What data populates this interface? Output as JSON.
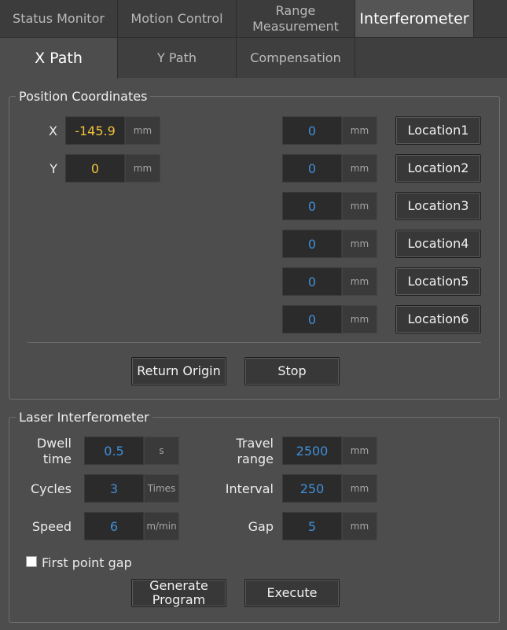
{
  "tabs_main": [
    {
      "label": "Status Monitor"
    },
    {
      "label": "Motion Control"
    },
    {
      "label": "Range Measurement"
    },
    {
      "label": "Interferometer"
    }
  ],
  "tabs_sub": [
    {
      "label": "X Path"
    },
    {
      "label": "Y Path"
    },
    {
      "label": "Compensation"
    }
  ],
  "position": {
    "title": "Position Coordinates",
    "x_label": "X",
    "x_value": "-145.9",
    "y_label": "Y",
    "y_value": "0",
    "unit": "mm",
    "locations": [
      {
        "value": "0",
        "unit": "mm",
        "button": "Location1"
      },
      {
        "value": "0",
        "unit": "mm",
        "button": "Location2"
      },
      {
        "value": "0",
        "unit": "mm",
        "button": "Location3"
      },
      {
        "value": "0",
        "unit": "mm",
        "button": "Location4"
      },
      {
        "value": "0",
        "unit": "mm",
        "button": "Location5"
      },
      {
        "value": "0",
        "unit": "mm",
        "button": "Location6"
      }
    ],
    "return_origin": "Return Origin",
    "stop": "Stop"
  },
  "laser": {
    "title": "Laser Interferometer",
    "dwell_label": "Dwell time",
    "dwell_value": "0.5",
    "dwell_unit": "s",
    "cycles_label": "Cycles",
    "cycles_value": "3",
    "cycles_unit": "Times",
    "speed_label": "Speed",
    "speed_value": "6",
    "speed_unit": "m/min",
    "travel_label": "Travel range",
    "travel_value": "2500",
    "travel_unit": "mm",
    "interval_label": "Interval",
    "interval_value": "250",
    "interval_unit": "mm",
    "gap_label": "Gap",
    "gap_value": "5",
    "gap_unit": "mm",
    "first_point_gap": "First point gap",
    "first_point_gap_checked": false,
    "generate": "Generate Program",
    "execute": "Execute"
  }
}
